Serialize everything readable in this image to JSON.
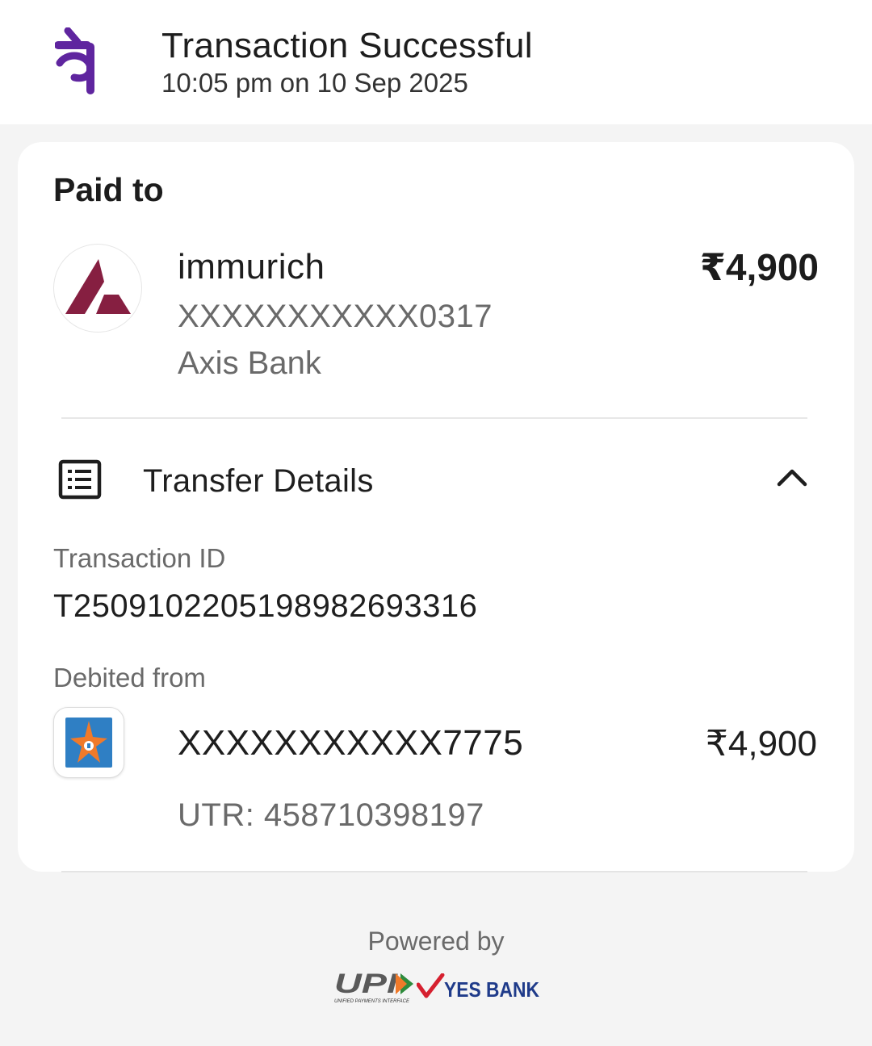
{
  "header": {
    "title": "Transaction Successful",
    "timestamp": "10:05 pm on 10 Sep 2025",
    "brand_icon": "phonepe-logo",
    "brand_color": "#5f259f"
  },
  "paid_to": {
    "label": "Paid to",
    "name": "immurich",
    "account": "XXXXXXXXXXX0317",
    "bank": "Axis Bank",
    "amount": "₹4,900",
    "logo": "axis-bank-logo",
    "logo_color": "#861f41"
  },
  "transfer_details": {
    "title": "Transfer Details",
    "icon": "receipt-list-icon",
    "toggle_icon": "chevron-up-icon",
    "transaction_id_label": "Transaction ID",
    "transaction_id": "T2509102205198982693316",
    "debited_from_label": "Debited from",
    "debit_account": "XXXXXXXXXXX7775",
    "debit_amount": "₹4,900",
    "utr": "UTR: 458710398197",
    "debit_bank_logo": "bank-of-india-logo",
    "debit_bank_color": "#2f7fc4"
  },
  "footer": {
    "powered_by": "Powered by",
    "upi_logo_text": "UPI",
    "upi_tagline": "UNIFIED PAYMENTS INTERFACE",
    "partner_logo_text": "YES BANK",
    "partner_color": "#1f3b8a"
  }
}
